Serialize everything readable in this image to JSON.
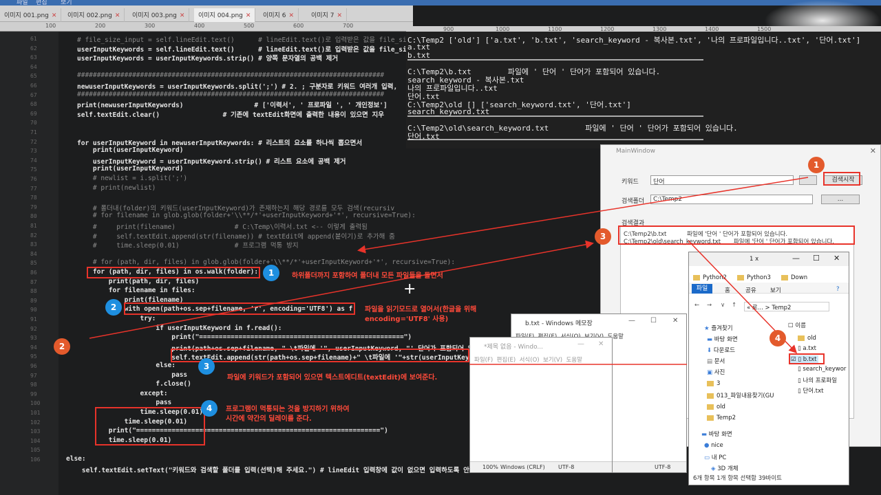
{
  "menu": {
    "items": [
      "파일",
      "편집",
      "보기"
    ]
  },
  "tabs": [
    {
      "label": "이미지 001.png"
    },
    {
      "label": "이미지 002.png"
    },
    {
      "label": "이미지 003.png"
    },
    {
      "label": "이미지 004.png"
    },
    {
      "label": "이미지 6"
    },
    {
      "label": "이미지 7"
    }
  ],
  "ruler": [
    "100",
    "200",
    "300",
    "400",
    "500",
    "600",
    "700"
  ],
  "console_ruler": [
    "900",
    "1000",
    "1100",
    "1200",
    "1300",
    "1400",
    "1500"
  ],
  "gutter": [
    "61",
    "62",
    "63",
    "64",
    "65",
    "66",
    "67",
    "68",
    "69",
    "70",
    "71",
    "72",
    "73",
    "74",
    "75",
    "76",
    "77",
    "78",
    "79",
    "80",
    "81",
    "82",
    "83",
    "84",
    "85",
    "86",
    "87",
    "88",
    "89",
    "90",
    "91",
    "92",
    "93",
    "94",
    "95",
    "96",
    "97",
    "98",
    "99",
    "100",
    "101",
    "102",
    "103",
    "104",
    "105",
    "106"
  ],
  "code": [
    "# file_size_input = self.lineEdit.text()      # lineEdit.text()로 입력받은 값을 file_si",
    "userInputKeywords = self.lineEdit.text()      # lineEdit.text()로 입력받은 값을 file_si",
    "userInputKeywords = userInputKeywords.strip() # 양쪽 문자열의 공백 제거",
    "",
    "##############################################################################",
    "newuserInputKeywords = userInputKeywords.split(';') # 2. ; 구분자로 키워드 여러개 입력,",
    "##############################################################################",
    "print(newuserInputKeywords)                  # ['이력서', ' 프로파일 ', ' 개인정보']",
    "self.textEdit.clear()                # 기존에 textEdit화면에 출력한 내용이 있으면 지우",
    "",
    "",
    "for userInputKeyword in newuserInputKeywords: # 리스트의 요소를 하나씩 뽑으면서",
    "    print(userInputKeyword)",
    "    userInputKeyword = userInputKeyword.strip() # 리스트 요소에 공백 제거",
    "    print(userInputKeyword)",
    "    # newlist = i.split(';')",
    "    # print(newlist)",
    "",
    "    # 폴더내(folder)의 키워드(userInputKeyword)가 존재하는지 해당 경로를 모두 검색(recursiv",
    "    # for filename in glob.glob(folder+'\\\\**/*'+userInputKeyword+'*', recursive=True):",
    "    #     print(filename)               # C:\\Temp\\이력서.txt <-- 이렇게 출력됨",
    "    #     self.textEdit.append(str(filename)) # textEdit에 append(붙이기)로 추가해 줌",
    "    #     time.sleep(0.01)              # 프로그램 먹통 방지",
    "",
    "    # for (path, dir, files) in glob.glob(folder+'\\\\**/*'+userInputKeyword+'*', recursive=True):",
    "    for (path, dir, files) in os.walk(folder):",
    "        print(path, dir, files)",
    "        for filename in files:",
    "            print(filename)",
    "            with open(path+os.sep+filename, 'r', encoding='UTF8') as f:",
    "                try:",
    "                    if userInputKeyword in f.read():",
    "                        print(\"====================================================\")",
    "                        print(path+os.sep+filename, \" \\t파일에 '\", userInputKeyword, \"' 단어가 포함되어 있",
    "                        self.textEdit.append(str(path+os.sep+filename)+\" \\t파일에 '\"+str(userInputKeywo",
    "                    else:",
    "                        pass",
    "                    f.close()",
    "                except:",
    "                    pass",
    "                time.sleep(0.01)",
    "            time.sleep(0.01)",
    "        print(\"==============================================================\")",
    "        time.sleep(0.01)",
    "",
    "else:",
    "    self.textEdit.setText(\"키워드와 검색할 폴더를 입력(선택)해 주세요.\") # lineEdit 입력창에 값이 없으면 입력하도록 안내"
  ],
  "console": [
    "C:\\Temp2 ['old'] ['a.txt', 'b.txt', 'search_keyword - 복사본.txt', '나의 프로파일입니다..txt', '단어.txt']",
    "a.txt",
    "b.txt",
    "",
    "C:\\Temp2\\b.txt        파일에 ' 단어 ' 단어가 포함되어 있습니다.",
    "search_keyword - 복사본.txt",
    "나의 프로파일입니다..txt",
    "단어.txt",
    "C:\\Temp2\\old [] ['search_keyword.txt', '단어.txt']",
    "search_keyword.txt",
    "",
    "C:\\Temp2\\old\\search_keyword.txt        파일에 ' 단어 ' 단어가 포함되어 있습니다.",
    "단어.txt"
  ],
  "notes": {
    "n1": "하위폴더까지 포함하여 폴더내 모든 파일들을 돌면서",
    "n2a": "파일을 읽기모드로 열어서(한글을 위해",
    "n2b": "encoding='UTF8' 사용)",
    "n3": "파일에 키워드가 포함되어 있으면 텍스트에디트(textEdit)에 보여준다.",
    "n4a": "프로그램이 먹통되는 것을 방지하기 위하여",
    "n4b": "시간에 약간의 딜레이를 준다."
  },
  "badges": {
    "b1": "1",
    "b2": "2",
    "b3": "3",
    "b4": "4"
  },
  "mainwindow": {
    "title": "MainWindow",
    "keyword_label": "키워드",
    "keyword_value": "단어",
    "search_button": "검색시작",
    "folder_label": "검색폴더",
    "folder_value": "C:\\Temp2",
    "browse_button": "...",
    "result_label": "검색결과",
    "results": [
      "C:\\Temp2\\b.txt           파일에 '단어 ' 단어가 포함되어 있습니다.",
      "C:\\Temp2\\old\\search_keyword.txt       파일에 '단어 ' 단어가 포함되어 있습니다."
    ]
  },
  "explorer": {
    "tab_title": "1 x",
    "tabs": [
      "Python2",
      "Python3",
      "Down"
    ],
    "ribbon": {
      "file": "파일",
      "home": "홈",
      "share": "공유",
      "view": "보기"
    },
    "path": "« 로... > Temp2",
    "col_name": "이름",
    "quick": [
      "즐겨찾기",
      "바탕 화면",
      "다운로드",
      "문서",
      "사진",
      "3",
      "013_파일내용찾기(GU",
      "old",
      "Temp2"
    ],
    "bottom": [
      "바탕 화면",
      "nice",
      "내 PC",
      "3D 개체"
    ],
    "files": [
      "old",
      "a.txt",
      "b.txt",
      "search_keywor",
      "나의 프로파일",
      "단어.txt"
    ],
    "status": "6개 항목     1개 항목 선택함 39바이트"
  },
  "notepad_b": {
    "title": "b.txt - Windows 메모장",
    "menu": "파일(F)  편집(E)  서식(O)  보기(V)  도움말",
    "status_zoom": "100%",
    "status_eol": "Windows (CRLF)",
    "status_enc": "UTF-8"
  },
  "notepad_new": {
    "title": "*제목 없음 - Windo...",
    "menu": "파일(F)  편집(E)  서식(O)  보기(V)  도움말",
    "status_enc": "UTF-8"
  },
  "colors": {
    "annotation": "#e8332a",
    "badge_blue": "#1e8fe0",
    "badge_orange": "#e35a2c"
  }
}
